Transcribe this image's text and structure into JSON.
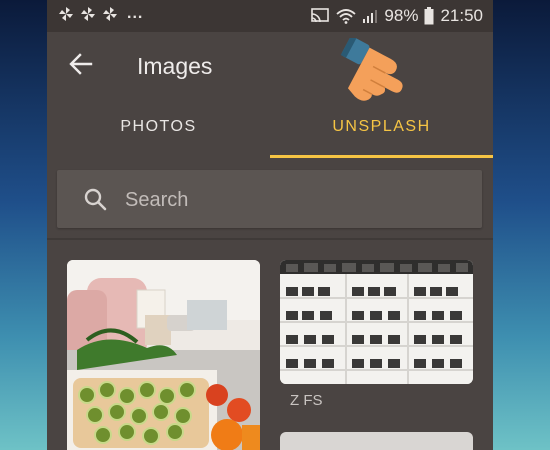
{
  "status_bar": {
    "dots": "...",
    "battery": "98%",
    "time": "21:50"
  },
  "toolbar": {
    "title": "Images"
  },
  "tabs": [
    {
      "label": "PHOTOS",
      "selected": false
    },
    {
      "label": "UNSPLASH",
      "selected": true
    }
  ],
  "search": {
    "placeholder": "Search",
    "value": ""
  },
  "results": [
    {
      "caption": ""
    },
    {
      "caption": "Z FS"
    },
    {
      "caption": ""
    }
  ],
  "colors": {
    "accent": "#f6c544",
    "app_bg": "#4a4442",
    "statusbar_bg": "#3c3634",
    "search_bg": "#5b5552"
  },
  "icons": {
    "back": "arrow-left-icon",
    "search": "search-icon",
    "pin": "pinwheel-icon",
    "cast": "cast-icon",
    "wifi": "wifi-icon",
    "signal": "signal-icon",
    "battery": "battery-icon",
    "pointer": "pointing-hand-icon"
  }
}
